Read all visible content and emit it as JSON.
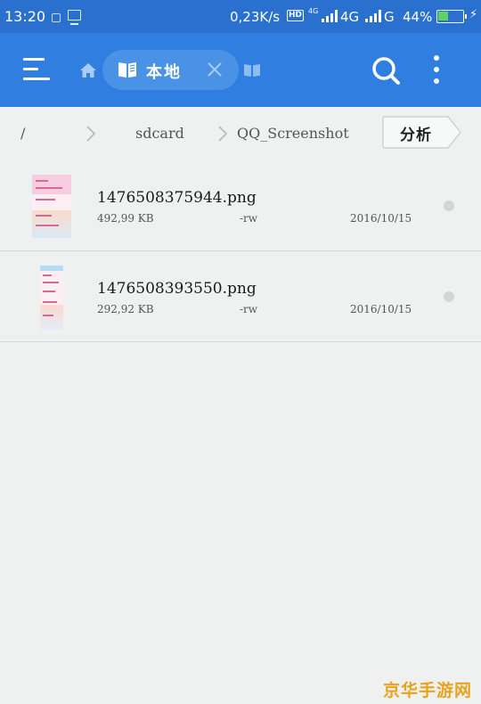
{
  "status_bar": {
    "time": "13:20",
    "net_speed": "0,23K/s",
    "hd_badge": "HD",
    "net_small": "4G",
    "net_label1": "4G",
    "net_label2": "G",
    "battery_percent": "44%",
    "battery_level": 0.44,
    "battery_fill_color": "#5fd35f",
    "charge_symbol": "⚡"
  },
  "app_bar": {
    "background": "#2f7ee0",
    "active_tab_label": "本地"
  },
  "breadcrumb": {
    "items": [
      "/",
      "sdcard",
      "QQ_Screenshot"
    ],
    "analyze_label": "分析"
  },
  "files": [
    {
      "name": "1476508375944.png",
      "size": "492,99 KB",
      "perm": "-rw",
      "date": "2016/10/15"
    },
    {
      "name": "1476508393550.png",
      "size": "292,92 KB",
      "perm": "-rw",
      "date": "2016/10/15"
    }
  ],
  "watermark": "京华手游网"
}
